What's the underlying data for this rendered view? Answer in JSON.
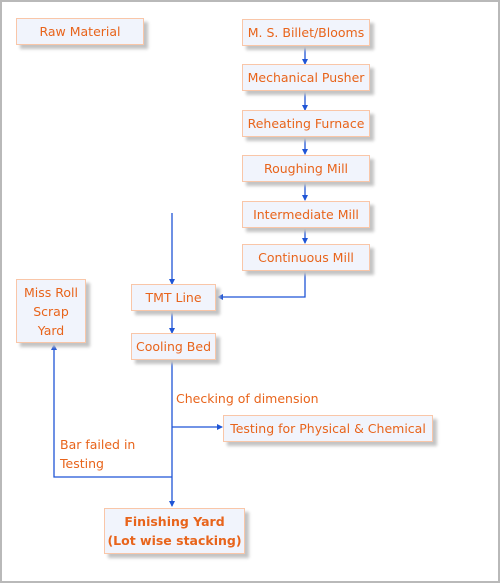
{
  "diagram": {
    "type": "process-flowchart",
    "colors": {
      "text": "#e8641b",
      "box_fill": "#f1f4fc",
      "box_border": "#f9c6a8",
      "connector": "#1f55d6",
      "frame": "#b9b9b9"
    },
    "nodes": {
      "raw_material": "Raw Material",
      "billet": "M. S. Billet/Blooms",
      "pusher": "Mechanical Pusher",
      "furnace": "Reheating Furnace",
      "roughing": "Roughing Mill",
      "intermediate": "Intermediate Mill",
      "continuous": "Continuous Mill",
      "tmt": "TMT Line",
      "cooling": "Cooling Bed",
      "scrap_line1": "Miss Roll",
      "scrap_line2": "Scrap",
      "scrap_line3": "Yard",
      "testing": "Testing for Physical & Chemical",
      "finishing_line1": "Finishing Yard",
      "finishing_line2": "(Lot wise stacking)"
    },
    "labels": {
      "checking": "Checking of dimension",
      "failed_line1": "Bar failed in",
      "failed_line2": "Testing"
    },
    "edges": [
      [
        "M. S. Billet/Blooms",
        "Mechanical Pusher"
      ],
      [
        "Mechanical Pusher",
        "Reheating Furnace"
      ],
      [
        "Reheating Furnace",
        "Roughing Mill"
      ],
      [
        "Roughing Mill",
        "Intermediate Mill"
      ],
      [
        "Intermediate Mill",
        "Continuous Mill"
      ],
      [
        "Continuous Mill",
        "TMT Line"
      ],
      [
        "TMT Line",
        "Cooling Bed"
      ],
      [
        "Cooling Bed",
        "Testing for Physical & Chemical"
      ],
      [
        "Cooling Bed",
        "Miss Roll Scrap Yard"
      ],
      [
        "Cooling Bed",
        "Finishing Yard (Lot wise stacking)"
      ]
    ]
  }
}
